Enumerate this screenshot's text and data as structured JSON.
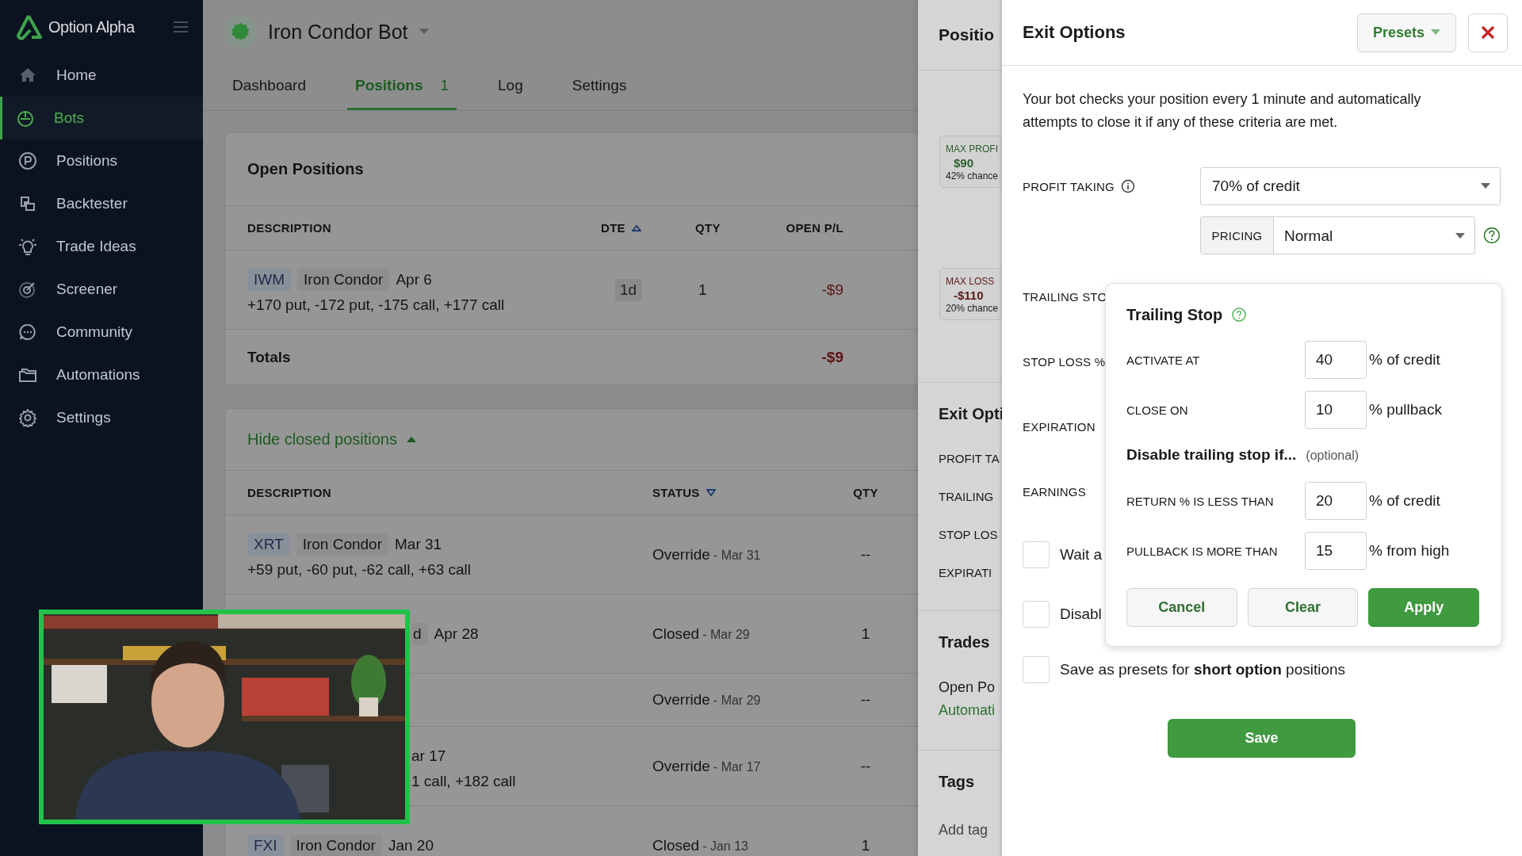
{
  "sidebar": {
    "brand": "Option Alpha",
    "items": [
      {
        "label": "Home",
        "selected": false
      },
      {
        "label": "Bots",
        "selected": true
      },
      {
        "label": "Positions",
        "selected": false
      },
      {
        "label": "Backtester",
        "selected": false
      },
      {
        "label": "Trade Ideas",
        "selected": false
      },
      {
        "label": "Screener",
        "selected": false
      },
      {
        "label": "Community",
        "selected": false
      },
      {
        "label": "Automations",
        "selected": false
      },
      {
        "label": "Settings",
        "selected": false
      }
    ]
  },
  "bot": {
    "name": "Iron Condor Bot"
  },
  "tabs": [
    {
      "label": "Dashboard",
      "selected": false
    },
    {
      "label": "Positions",
      "count": "1",
      "selected": true
    },
    {
      "label": "Log",
      "selected": false
    },
    {
      "label": "Settings",
      "selected": false
    }
  ],
  "open_positions": {
    "title": "Open Positions",
    "columns": [
      {
        "label": "DESCRIPTION"
      },
      {
        "label": "DTE",
        "sorted": true,
        "ascending": true
      },
      {
        "label": "QTY"
      },
      {
        "label": "OPEN P/L"
      }
    ],
    "rows": [
      {
        "symbol": "IWM",
        "strategy": "Iron Condor",
        "date": "Apr 6",
        "legs": "+170 put, -172 put, -175 call, +177 call",
        "dte": "1d",
        "qty": "1",
        "pl": "-$9"
      }
    ],
    "totals": {
      "label": "Totals",
      "pl": "-$9"
    }
  },
  "closed_positions": {
    "toggle": "Hide closed positions",
    "expanded": true,
    "columns": [
      {
        "label": "DESCRIPTION"
      },
      {
        "label": "STATUS",
        "sorted": true,
        "ascending": false
      },
      {
        "label": "QTY"
      }
    ],
    "rows": [
      {
        "symbol": "XRT",
        "strategy": "Iron Condor",
        "date": "Mar 31",
        "legs": "+59 put, -60 put, -62 call, +63 call",
        "status": "Override",
        "status_date": "- Mar 31",
        "qty": "--"
      },
      {
        "strategy_tail": "d",
        "date": "Apr 28",
        "status": "Closed",
        "status_date": "- Mar 29",
        "qty": "1"
      },
      {
        "status": "Override",
        "status_date": "- Mar 29",
        "qty": "--"
      },
      {
        "date": "ar 17",
        "legs": "1 call, +182 call",
        "status": "Override",
        "status_date": "- Mar 17",
        "qty": "--"
      },
      {
        "symbol": "FXI",
        "strategy": "Iron Condor",
        "date": "Jan 20",
        "status": "Closed",
        "status_date": "- Jan 13",
        "qty": "1"
      }
    ]
  },
  "summary_panel": {
    "title": "Positio",
    "max_profit": {
      "label": "MAX PROFI",
      "value": "$90",
      "chance": "42% chance"
    },
    "max_loss": {
      "label": "MAX LOSS",
      "value": "-$110",
      "chance": "20% chance"
    },
    "exit_title": "Exit Opti",
    "exit_items": [
      "PROFIT TA",
      "TRAILING",
      "STOP LOS",
      "EXPIRATI"
    ],
    "trades_title": "Trades",
    "trades_text": "Open Po",
    "trades_link": "Automati",
    "tags_title": "Tags",
    "add_tag": "Add tag"
  },
  "exit_options": {
    "title": "Exit Options",
    "presets": "Presets",
    "description": "Your bot checks your position every 1 minute and automatically attempts to close it if any of these criteria are met.",
    "profit_taking": {
      "label": "PROFIT TAKING",
      "value": "70% of credit",
      "pricing_label": "PRICING",
      "pricing": "Normal"
    },
    "labels": [
      "TRAILING STO",
      "STOP LOSS %",
      "EXPIRATION",
      "EARNINGS"
    ],
    "checkboxes": [
      {
        "label": "Wait a",
        "checked": false
      },
      {
        "label": "Disabl",
        "checked": false
      },
      {
        "label": "Save as presets for **short option** positions",
        "checked": false
      }
    ],
    "save": "Save"
  },
  "trailing_stop": {
    "title": "Trailing Stop",
    "fields": [
      {
        "label": "ACTIVATE AT",
        "value": "40",
        "unit": "% of credit"
      },
      {
        "label": "CLOSE ON",
        "value": "10",
        "unit": "% pullback"
      }
    ],
    "disable_heading": "Disable trailing stop if...",
    "disable_note": "(optional)",
    "disable_fields": [
      {
        "label": "RETURN % IS LESS THAN",
        "value": "20",
        "unit": "% of credit"
      },
      {
        "label": "PULLBACK IS MORE THAN",
        "value": "15",
        "unit": "% from high"
      }
    ],
    "buttons": [
      {
        "label": "Cancel",
        "kind": "secondary"
      },
      {
        "label": "Clear",
        "kind": "secondary"
      },
      {
        "label": "Apply",
        "kind": "primary"
      }
    ]
  }
}
